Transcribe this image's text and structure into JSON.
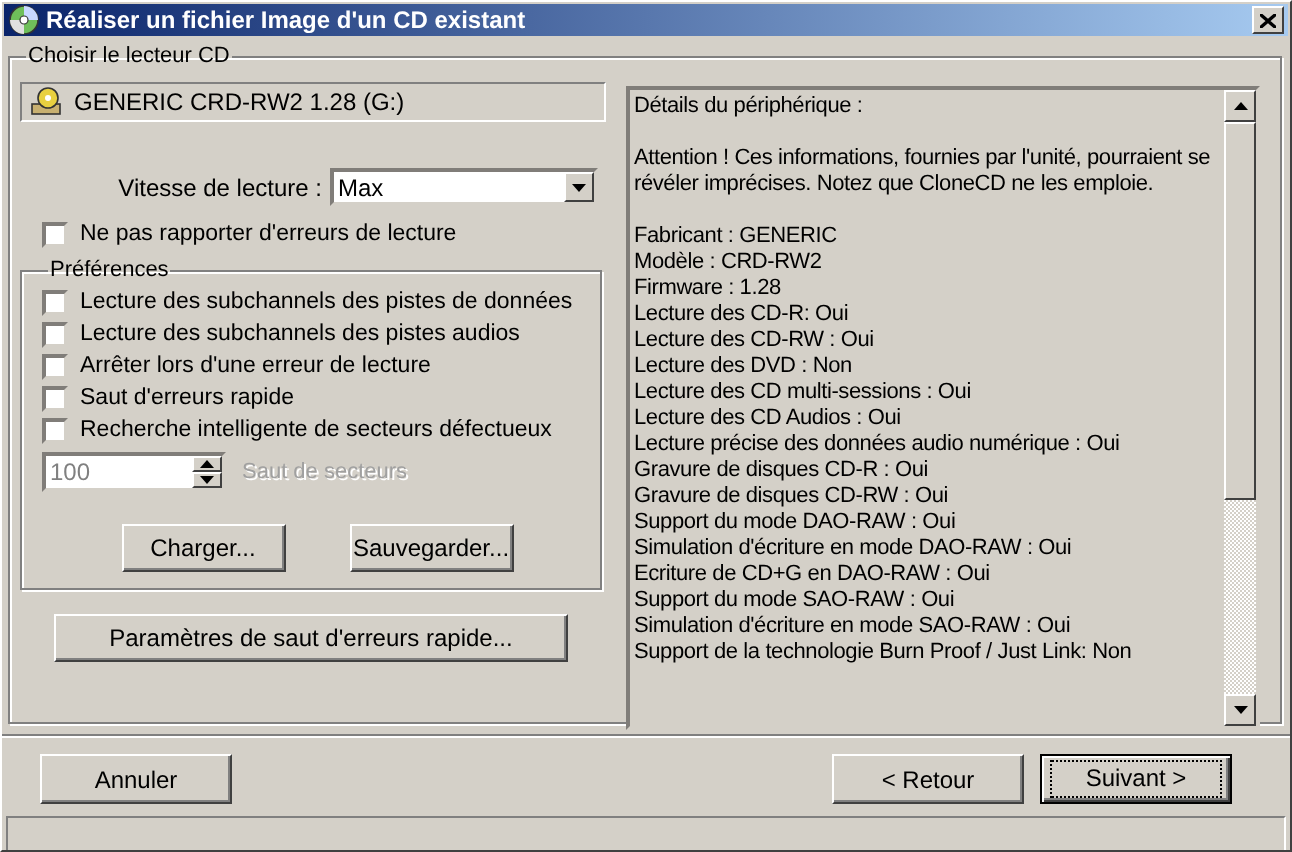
{
  "window": {
    "title": "Réaliser un fichier Image d'un CD existant"
  },
  "drive_group": {
    "title": "Choisir le lecteur CD",
    "drive": "GENERIC CRD-RW2 1.28 (G:)",
    "speed": {
      "label": "Vitesse de lecture :",
      "value": "Max"
    },
    "no_errors": {
      "label": "Ne pas rapporter d'erreurs de lecture",
      "checked": false
    }
  },
  "preferences": {
    "title": "Préférences",
    "options": [
      {
        "label": "Lecture des subchannels des pistes de données",
        "checked": false
      },
      {
        "label": "Lecture des subchannels des pistes audios",
        "checked": false
      },
      {
        "label": "Arrêter lors d'une erreur de lecture",
        "checked": false
      },
      {
        "label": "Saut d'erreurs rapide",
        "checked": false
      },
      {
        "label": "Recherche intelligente de secteurs défectueux",
        "checked": false
      }
    ],
    "sector_skip": {
      "value": "100",
      "label": "Saut de secteurs",
      "disabled": true
    },
    "buttons": [
      "Charger...",
      "Sauvegarder..."
    ]
  },
  "fast_skip_button": "Paramètres de saut d'erreurs rapide...",
  "details": {
    "heading": "Détails du périphérique :",
    "warning": "Attention ! Ces informations, fournies par l'unité, pourraient se révéler imprécises. Notez que CloneCD ne les emploie.",
    "lines": [
      "Fabricant : GENERIC",
      "Modèle : CRD-RW2",
      "Firmware : 1.28",
      "Lecture des CD-R: Oui",
      "Lecture des CD-RW : Oui",
      "Lecture des DVD : Non",
      "Lecture des CD multi-sessions : Oui",
      "Lecture des CD Audios : Oui",
      "Lecture précise des données audio numérique : Oui",
      "Gravure de disques CD-R : Oui",
      "Gravure de disques CD-RW : Oui",
      "Support du mode DAO-RAW : Oui",
      "Simulation d'écriture en mode DAO-RAW : Oui",
      "Ecriture de CD+G en DAO-RAW : Oui",
      "Support du mode SAO-RAW : Oui",
      "Simulation d'écriture en mode SAO-RAW : Oui",
      "Support de la technologie Burn Proof / Just Link: Non"
    ]
  },
  "footer": {
    "cancel": "Annuler",
    "back": "< Retour",
    "next": "Suivant >"
  }
}
